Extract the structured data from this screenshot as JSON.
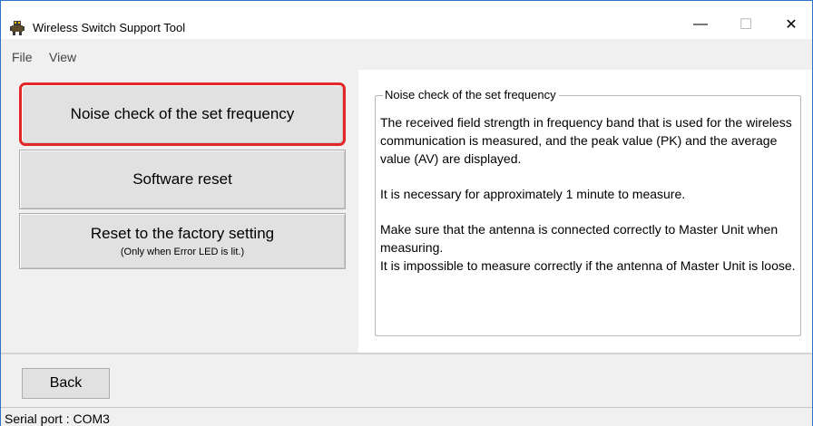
{
  "window": {
    "title": "Wireless Switch Support Tool",
    "minimize_glyph": "—",
    "maximize_glyph": "☐",
    "close_glyph": "✕",
    "app_icon": "robot-icon"
  },
  "menu": {
    "items": [
      {
        "label": "File"
      },
      {
        "label": "View"
      }
    ]
  },
  "actions": {
    "noise_check": "Noise check of the set frequency",
    "software_reset": "Software reset",
    "factory_reset": "Reset to the factory setting",
    "factory_reset_note": "(Only when Error LED is lit.)"
  },
  "description": {
    "title": "Noise check of the set frequency",
    "paragraphs": [
      "The received field strength in frequency band that is used for the wireless communication is measured, and the peak value (PK) and the average value (AV) are displayed.",
      "It is necessary for approximately 1 minute to measure.",
      "Make sure that the antenna is connected correctly to Master Unit when measuring.\nIt is impossible to measure correctly if the antenna of Master Unit is loose."
    ]
  },
  "footer": {
    "back_label": "Back"
  },
  "status": {
    "serial_port": "Serial port :  COM3"
  },
  "colors": {
    "highlight_border": "#e32626",
    "window_border": "#2b74c9"
  }
}
